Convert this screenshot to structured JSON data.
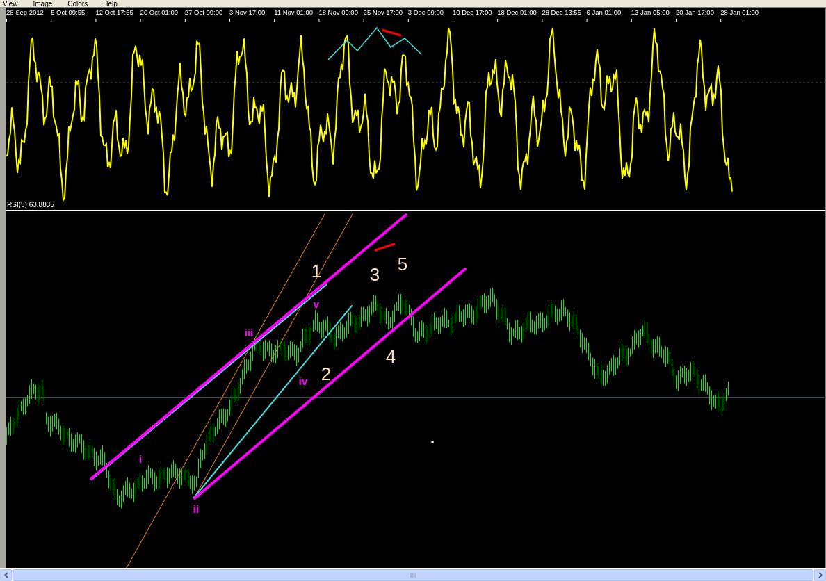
{
  "menu": [
    "View",
    "Image",
    "Colors",
    "Help"
  ],
  "time_axis": {
    "labels": [
      "28 Sep 2012",
      "5 Oct 09:55",
      "12 Oct 17:55",
      "20 Oct 01:00",
      "27 Oct 09:00",
      "3 Nov 17:00",
      "11 Nov 01:00",
      "18 Nov 09:00",
      "25 Nov 17:00",
      "3 Dec 09:00",
      "10 Dec 17:00",
      "18 Dec 01:00",
      "28 Dec 13:55",
      "6 Jan 01:00",
      "13 Jan 05:00",
      "20 Jan 17:00",
      "28 Jan 01:00"
    ]
  },
  "rsi_pane": {
    "label": "RSI(5) 63.8835"
  },
  "price_pane": {
    "wave_labels": [
      {
        "text": "i",
        "kind": "roman",
        "color": "#ff00ff"
      },
      {
        "text": "ii",
        "kind": "roman",
        "color": "#ff00ff"
      },
      {
        "text": "iii",
        "kind": "roman",
        "color": "#ff00ff"
      },
      {
        "text": "iv",
        "kind": "roman",
        "color": "#ff00ff"
      },
      {
        "text": "v",
        "kind": "roman",
        "color": "#ff00ff"
      },
      {
        "text": "1",
        "kind": "number",
        "color": "#ffe4c4"
      },
      {
        "text": "2",
        "kind": "number",
        "color": "#ffe4c4"
      },
      {
        "text": "3",
        "kind": "number",
        "color": "#ffe4c4"
      },
      {
        "text": "4",
        "kind": "number",
        "color": "#ffe4c4"
      },
      {
        "text": "5",
        "kind": "number",
        "color": "#ffe4c4"
      }
    ]
  }
}
